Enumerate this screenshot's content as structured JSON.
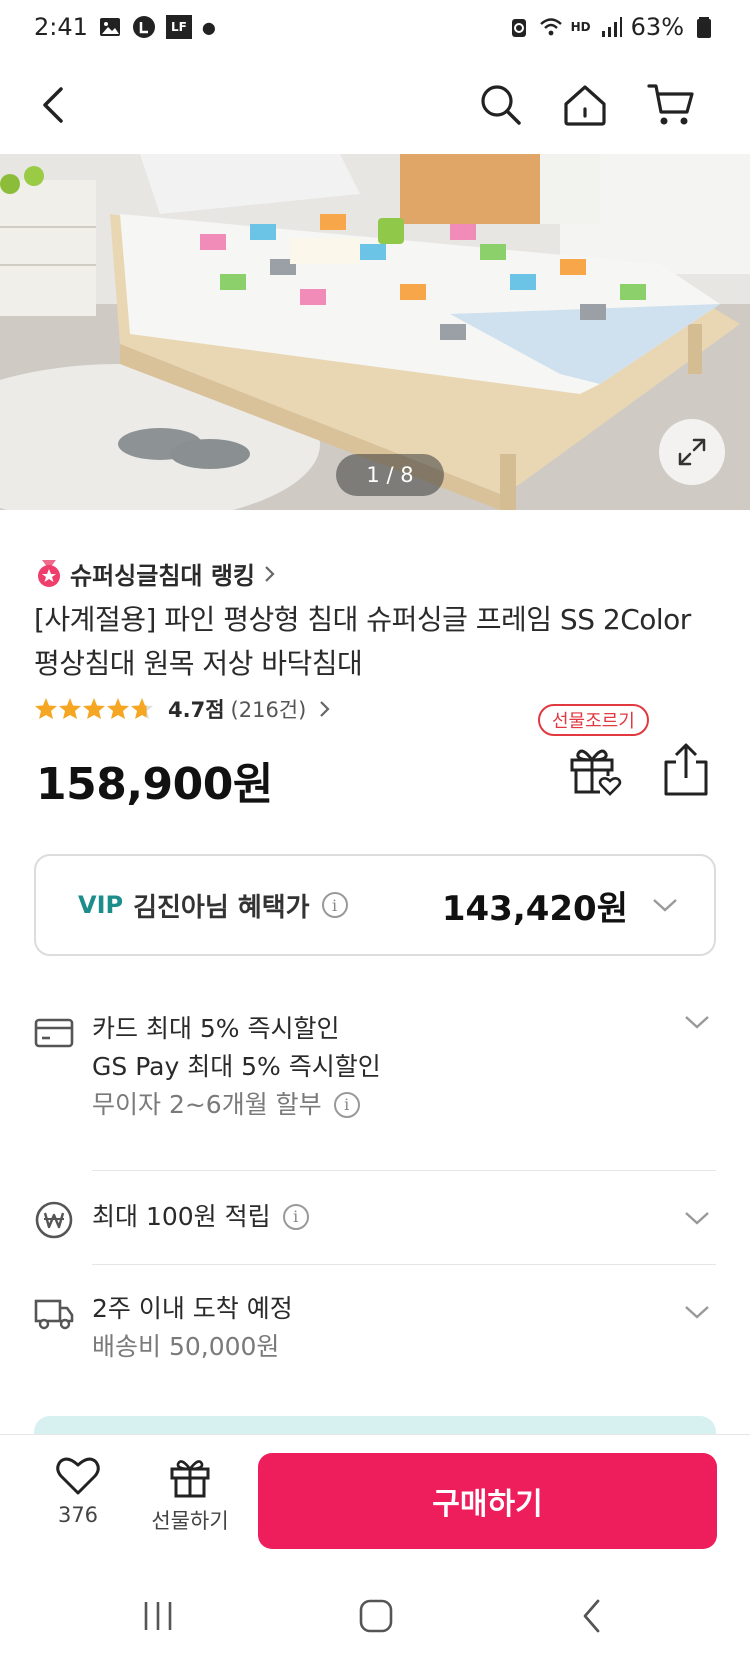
{
  "status_bar": {
    "time": "2:41",
    "battery": "63%",
    "hd_label": "HD",
    "notification_badge": "LF"
  },
  "nav": {
    "back_icon": "chevron-left-icon",
    "search_icon": "search-icon",
    "home_icon": "home-icon",
    "cart_icon": "cart-icon"
  },
  "gallery": {
    "page_indicator": "1 / 8"
  },
  "product": {
    "ranking": "슈퍼싱글침대 랭킹",
    "title": "[사계절용] 파인 평상형 침대 슈퍼싱글 프레임 SS 2Color 평상침대 원목 저상 바닥침대",
    "rating_score": "4.7점",
    "review_count": "(216건)",
    "stars": 4.7,
    "price": "158,900원",
    "gift_badge": "선물조르기"
  },
  "vip": {
    "label": "VIP",
    "text": "김진아님 혜택가",
    "price": "143,420원"
  },
  "benefits": {
    "card": {
      "line1": "카드 최대 5% 즉시할인",
      "line2": "GS Pay 최대 5% 즉시할인",
      "line3": "무이자 2~6개월 할부"
    },
    "points": {
      "line1": "최대 100원 적립"
    },
    "delivery": {
      "line1": "2주 이내 도착 예정",
      "line2": "배송비 50,000원"
    }
  },
  "bottom_bar": {
    "wish_count": "376",
    "gift_label": "선물하기",
    "buy_label": "구매하기"
  },
  "colors": {
    "accent": "#ee1d5c",
    "vip": "#1b8d8a",
    "star": "#f5a623",
    "gift_badge": "#e2383f"
  }
}
